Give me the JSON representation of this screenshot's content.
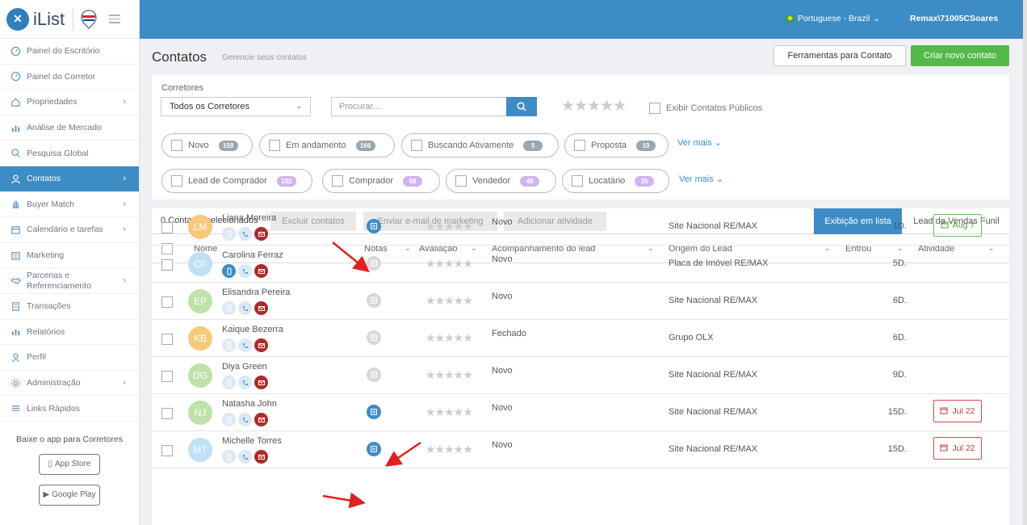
{
  "brand": {
    "name": "iList"
  },
  "nav": [
    {
      "label": "Painel do Escritório",
      "icon": "gauge-icon",
      "chev": ""
    },
    {
      "label": "Painel do Corretor",
      "icon": "gauge-icon",
      "chev": ""
    },
    {
      "label": "Propriedades",
      "icon": "home-icon",
      "chev": "›"
    },
    {
      "label": "Análise de Mercado",
      "icon": "bar-chart-icon",
      "chev": ""
    },
    {
      "label": "Pesquisa Global",
      "icon": "search-icon",
      "chev": ""
    },
    {
      "label": "Contatos",
      "icon": "users-icon",
      "chev": "›"
    },
    {
      "label": "Buyer Match",
      "icon": "hand-icon",
      "chev": "›"
    },
    {
      "label": "Calendário e tarefas",
      "icon": "calendar-icon",
      "chev": "›"
    },
    {
      "label": "Marketing",
      "icon": "newspaper-icon",
      "chev": ""
    },
    {
      "label": "Parcerias e Referenciamento",
      "icon": "handshake-icon",
      "chev": "›"
    },
    {
      "label": "Transações",
      "icon": "building-icon",
      "chev": ""
    },
    {
      "label": "Relatórios",
      "icon": "bar-chart-icon",
      "chev": ""
    },
    {
      "label": "Perfil",
      "icon": "user-icon",
      "chev": ""
    },
    {
      "label": "Administração",
      "icon": "gear-icon",
      "chev": "›"
    },
    {
      "label": "Links Rápidos",
      "icon": "list-icon",
      "chev": ""
    }
  ],
  "app_download": {
    "title": "Baixe o app para Corretores",
    "app_store": "App Store",
    "google_play": "Google Play"
  },
  "topbar": {
    "language": "Portuguese - Brazil",
    "user": "Remax\\71005CSoares"
  },
  "header": {
    "title": "Contatos",
    "subtitle": "Gerencie seus contatos",
    "tools_button": "Ferramentas para Contato",
    "new_button": "Criar novo contato"
  },
  "filters": {
    "brokers_label": "Corretores",
    "brokers_value": "Todos os Corretores",
    "search_placeholder": "Procurar...",
    "public_label": "Exibir Contatos Públicos",
    "status_chips": [
      {
        "label": "Novo",
        "count": "159"
      },
      {
        "label": "Em andamento",
        "count": "166"
      },
      {
        "label": "Buscando Ativamente",
        "count": "5"
      },
      {
        "label": "Proposta",
        "count": "10"
      }
    ],
    "type_chips": [
      {
        "label": "Lead de Comprador",
        "count": "102"
      },
      {
        "label": "Comprador",
        "count": "58"
      },
      {
        "label": "Vendedor",
        "count": "48"
      },
      {
        "label": "Locatário",
        "count": "26"
      }
    ],
    "more_label": "Ver mais ⌄"
  },
  "toolbar": {
    "selected": "0 Contatos selecionados",
    "delete": "Excluir contatos",
    "email": "Enviar e-mail de marketing",
    "activity": "Adicionar atividade",
    "view_list": "Exibição em lista",
    "view_funnel": "Lead de Vendas Funil"
  },
  "columns": {
    "name": "Nome",
    "notes": "Notas",
    "rating": "Avaliação",
    "lead": "Acompanhamento do lead",
    "origin": "Origem do Lead",
    "entered": "Entrou",
    "activity": "Atividade"
  },
  "rows": [
    {
      "initials": "LM",
      "name": "Liana Moreira",
      "avatar_color": "#f9c97a",
      "phone_on": false,
      "note_on": true,
      "stars": "★★★★★",
      "lead": "Novo",
      "origin": "Site Nacional RE/MAX",
      "entered": "1D.",
      "activity": "Aug 7",
      "activity_type": "green"
    },
    {
      "initials": "CF",
      "name": "Carolina Ferraz",
      "avatar_color": "#bfe0f5",
      "phone_on": true,
      "note_on": false,
      "stars": "★★★★★",
      "lead": "Novo",
      "origin": "Placa de Imóvel RE/MAX",
      "entered": "5D.",
      "activity": "",
      "activity_type": ""
    },
    {
      "initials": "EP",
      "name": "Elisandra Pereira",
      "avatar_color": "#bfe2a8",
      "phone_on": false,
      "note_on": false,
      "stars": "★★★★★",
      "lead": "Novo",
      "origin": "Site Nacional RE/MAX",
      "entered": "6D.",
      "activity": "",
      "activity_type": ""
    },
    {
      "initials": "KB",
      "name": "Kaique Bezerra",
      "avatar_color": "#f9c97a",
      "phone_on": false,
      "note_on": false,
      "stars": "★★★★★",
      "lead": "Fechado",
      "origin": "Grupo OLX",
      "entered": "6D.",
      "activity": "",
      "activity_type": ""
    },
    {
      "initials": "DG",
      "name": "Diya Green",
      "avatar_color": "#bfe2a8",
      "phone_on": false,
      "note_on": false,
      "stars": "★★★★★",
      "lead": "Novo",
      "origin": "Site Nacional RE/MAX",
      "entered": "9D.",
      "activity": "",
      "activity_type": ""
    },
    {
      "initials": "NJ",
      "name": "Natasha John",
      "avatar_color": "#bfe2a8",
      "phone_on": false,
      "note_on": true,
      "stars": "★★★★★",
      "lead": "Novo",
      "origin": "Site Nacional RE/MAX",
      "entered": "15D.",
      "activity": "Jul 22",
      "activity_type": "red"
    },
    {
      "initials": "MT",
      "name": "Michelle Torres",
      "avatar_color": "#bfe0f5",
      "phone_on": false,
      "note_on": true,
      "stars": "★★★★★",
      "lead": "Novo",
      "origin": "Site Nacional RE/MAX",
      "entered": "15D.",
      "activity": "Jul 22",
      "activity_type": "red"
    }
  ],
  "colors": {
    "primary": "#3d8cc6",
    "success": "#55b94a",
    "danger": "#b02a2a",
    "annotation_arrow": "#e0201e"
  }
}
